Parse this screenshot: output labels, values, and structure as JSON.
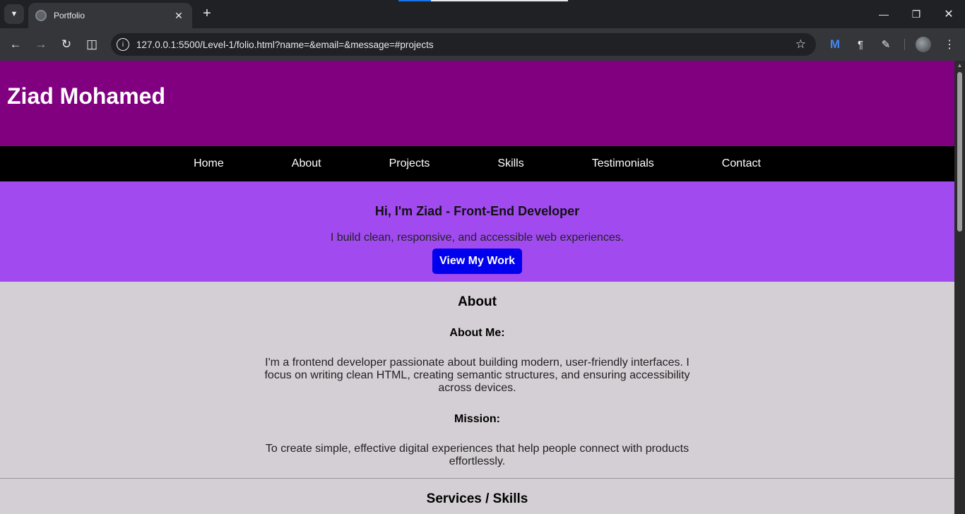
{
  "browser": {
    "tab_title": "Portfolio",
    "url": "127.0.0.1:5500/Level-1/folio.html?name=&email=&message=#projects",
    "icons": [
      "tab-search-icon",
      "favicon-icon",
      "close-icon",
      "plus-icon",
      "back-icon",
      "forward-icon",
      "reload-icon",
      "split-view-icon",
      "site-info-icon",
      "star-icon",
      "extension-m-icon",
      "extension-t-icon",
      "puzzle-icon",
      "profile-icon",
      "kebab-icon",
      "minimize-icon",
      "maximize-icon",
      "window-close-icon"
    ]
  },
  "site": {
    "name": "Ziad Mohamed",
    "nav": [
      "Home",
      "About",
      "Projects",
      "Skills",
      "Testimonials",
      "Contact"
    ],
    "hero": {
      "title": "Hi, I'm Ziad - Front-End Developer",
      "subtitle": "I build clean, responsive, and accessible web experiences.",
      "cta": "View My Work"
    },
    "about": {
      "heading": "About",
      "about_me_heading": "About Me:",
      "about_me_text": "I'm a frontend developer passionate about building modern, user-friendly interfaces. I focus on writing clean HTML, creating semantic structures, and ensuring accessibility across devices.",
      "mission_heading": "Mission:",
      "mission_text": "To create simple, effective digital experiences that help people connect with products effortlessly."
    },
    "services_heading": "Services / Skills"
  },
  "colors": {
    "header": "#800080",
    "nav": "#000000",
    "hero": "#a04aef",
    "cta": "#0000ee",
    "body": "#d4cfd4"
  }
}
